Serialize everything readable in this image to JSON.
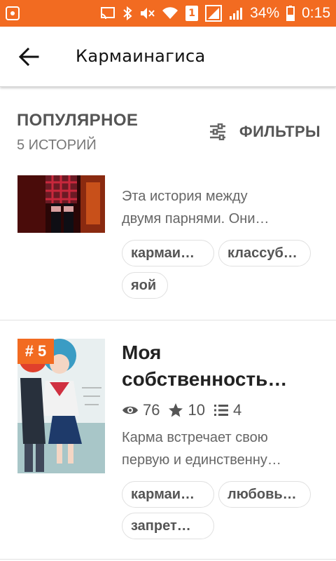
{
  "status_bar": {
    "battery": "34%",
    "time": "0:15",
    "sim": "1",
    "icons": [
      "notification-icon",
      "cast-icon",
      "bluetooth-icon",
      "mute-icon",
      "wifi-icon",
      "sim-icon",
      "signal-icon",
      "signal-bars-icon",
      "battery-icon"
    ],
    "bg_color": "#f26b21"
  },
  "app_bar": {
    "title": "Кармаинагиса"
  },
  "section": {
    "title": "ПОПУЛЯРНОЕ",
    "count": "5 ИСТОРИЙ",
    "filters_label": "ФИЛЬТРЫ"
  },
  "stories": [
    {
      "description": [
        "Эта история между",
        "двумя парнями. Они…"
      ],
      "tags": [
        "кармаи…",
        "классуб…",
        "яой"
      ]
    },
    {
      "rank": "# 5",
      "title": [
        "Моя",
        "собственность…"
      ],
      "views": "76",
      "votes": "10",
      "parts": "4",
      "description": [
        "Карма встречает свою",
        "первую и единственну…"
      ],
      "tags": [
        "кармаи…",
        "любовь…",
        "запрет…"
      ]
    }
  ],
  "colors": {
    "accent": "#f26b21",
    "text_primary": "#222222",
    "text_secondary": "#555555"
  }
}
